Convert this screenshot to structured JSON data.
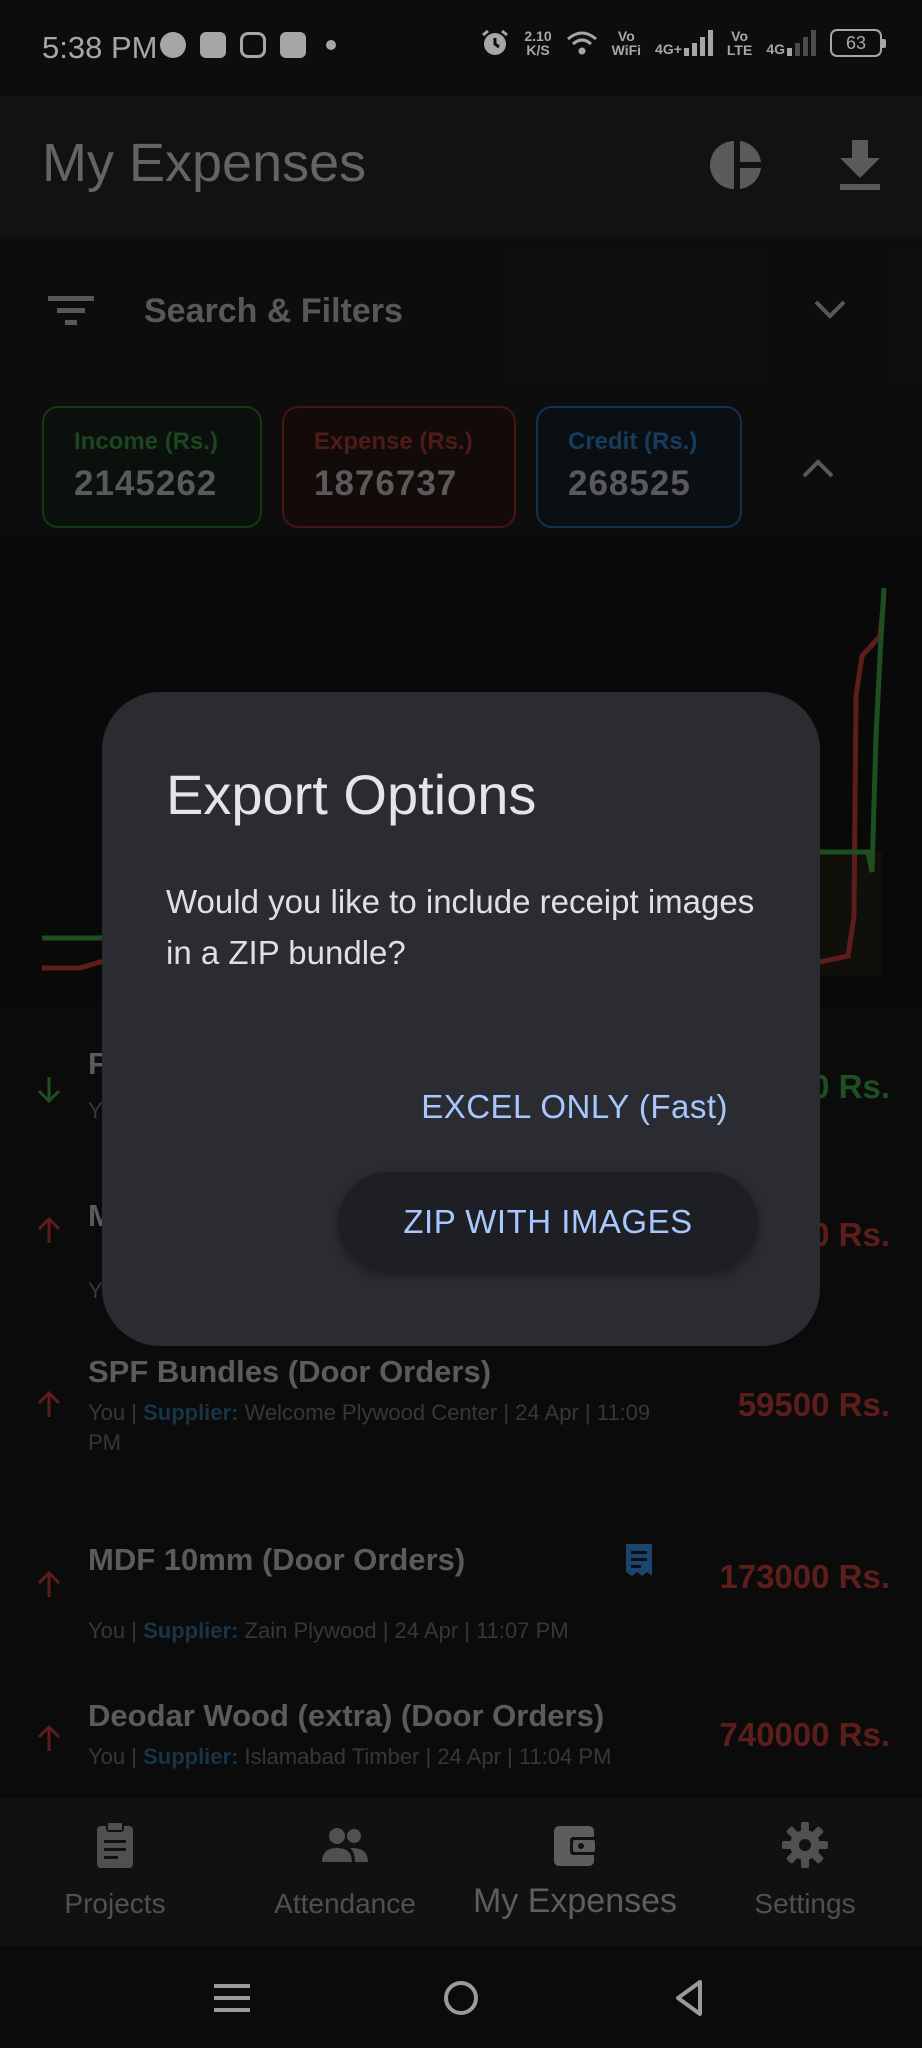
{
  "status_bar": {
    "time": "5:38 PM",
    "net_speed_value": "2.10",
    "net_speed_unit": "K/S",
    "vo_wifi_top": "Vo",
    "vo_wifi_bottom": "WiFi",
    "sim1_tech": "4G+",
    "vo_lte_top": "Vo",
    "vo_lte_bottom": "LTE",
    "sim2_tech": "4G",
    "battery": "63"
  },
  "appbar": {
    "title": "My Expenses",
    "icons": [
      "pie-chart-icon",
      "download-icon"
    ]
  },
  "filters": {
    "label": "Search & Filters"
  },
  "summary": {
    "income_label": "Income (Rs.)",
    "income_value": "2145262",
    "expense_label": "Expense (Rs.)",
    "expense_value": "1876737",
    "credit_label": "Credit (Rs.)",
    "credit_value": "268525"
  },
  "transactions": [
    {
      "direction": "in",
      "title": "F",
      "meta_prefix": "Y",
      "supplier_label": "",
      "meta_suffix": "",
      "amount": "0 Rs."
    },
    {
      "direction": "out",
      "title": "M",
      "meta_prefix": "Y",
      "supplier_label": "",
      "meta_suffix": "",
      "amount": "0 Rs."
    },
    {
      "direction": "out",
      "title": "SPF Bundles (Door Orders)",
      "meta_prefix": "You | ",
      "supplier_label": "Supplier:",
      "meta_suffix": " Welcome Plywood Center | 24 Apr | 11:09 PM",
      "amount": "59500 Rs."
    },
    {
      "direction": "out",
      "title": "MDF 10mm (Door Orders)",
      "meta_prefix": "You | ",
      "supplier_label": "Supplier:",
      "meta_suffix": " Zain Plywood | 24 Apr | 11:07 PM",
      "amount": "173000 Rs."
    },
    {
      "direction": "out",
      "title": "Deodar Wood (extra) (Door Orders)",
      "meta_prefix": "You | ",
      "supplier_label": "Supplier:",
      "meta_suffix": " Islamabad Timber | 24 Apr | 11:04 PM",
      "amount": "740000 Rs."
    }
  ],
  "bottom_nav": [
    {
      "label": "Projects",
      "icon": "clipboard-icon"
    },
    {
      "label": "Attendance",
      "icon": "people-icon"
    },
    {
      "label": "My Expenses",
      "icon": "wallet-icon",
      "active": true
    },
    {
      "label": "Settings",
      "icon": "gear-icon"
    }
  ],
  "dialog": {
    "title": "Export Options",
    "message": "Would you like to include receipt images in a ZIP bundle?",
    "excel_button": "EXCEL ONLY (Fast)",
    "zip_button": "ZIP WITH IMAGES"
  },
  "colors": {
    "income": "#2e7a34",
    "expense": "#8f2d28",
    "credit": "#255c8e",
    "accent": "#a9c7ff",
    "dialog_bg": "#2a2c31"
  }
}
